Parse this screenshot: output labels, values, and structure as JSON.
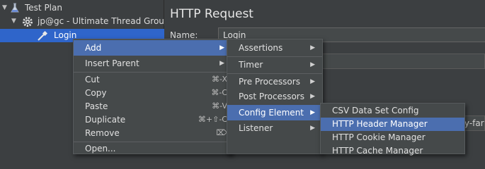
{
  "tree": {
    "items": [
      {
        "label": "Test Plan",
        "icon": "flask-icon"
      },
      {
        "label": "jp@gc - Ultimate Thread Group",
        "icon": "gear-icon"
      },
      {
        "label": "Login",
        "icon": "pipette-icon"
      }
    ]
  },
  "panel": {
    "title": "HTTP Request",
    "name_label": "Name:",
    "name_value": "Login",
    "hidden_fragment": "ry-far"
  },
  "context_menu": {
    "items": [
      {
        "label": "Add",
        "has_submenu": true
      },
      {
        "label": "Insert Parent",
        "has_submenu": true
      },
      {
        "label": "Cut",
        "shortcut": "⌘-X"
      },
      {
        "label": "Copy",
        "shortcut": "⌘-C"
      },
      {
        "label": "Paste",
        "shortcut": "⌘-V"
      },
      {
        "label": "Duplicate",
        "shortcut": "⌘+⇧-C"
      },
      {
        "label": "Remove",
        "shortcut": "⌦"
      },
      {
        "label": "Open..."
      }
    ]
  },
  "add_menu": {
    "items": [
      {
        "label": "Assertions"
      },
      {
        "label": "Timer"
      },
      {
        "label": "Pre Processors"
      },
      {
        "label": "Post Processors"
      },
      {
        "label": "Config Element"
      },
      {
        "label": "Listener"
      }
    ]
  },
  "config_menu": {
    "items": [
      {
        "label": "CSV Data Set Config"
      },
      {
        "label": "HTTP Header Manager"
      },
      {
        "label": "HTTP Cookie Manager"
      },
      {
        "label": "HTTP Cache Manager"
      }
    ]
  },
  "colors": {
    "background": "#3c3f41",
    "menu": "#45494a",
    "selection": "#4b6eaf",
    "tree_selection": "#2f65ca"
  }
}
